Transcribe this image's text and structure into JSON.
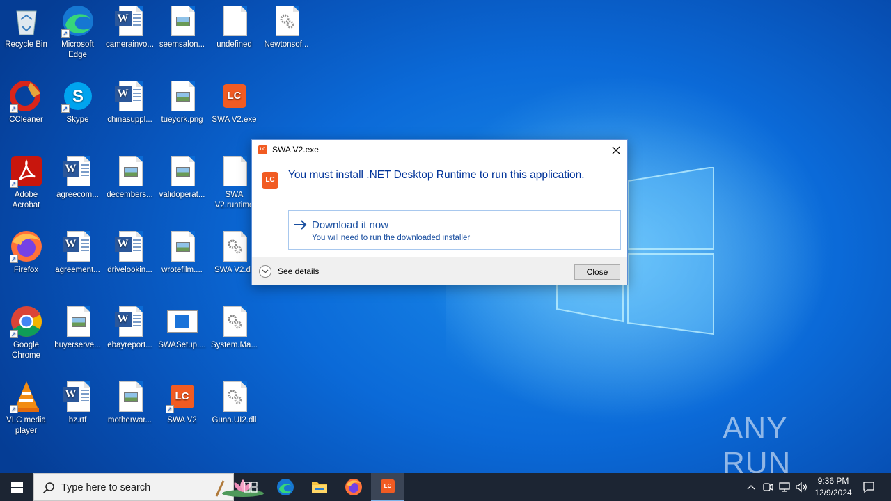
{
  "desktop": {
    "icons": [
      {
        "label": "Recycle Bin",
        "kind": "recycle-bin"
      },
      {
        "label": "Microsoft Edge",
        "kind": "edge"
      },
      {
        "label": "camerainvo...",
        "kind": "word"
      },
      {
        "label": "seemsalon...",
        "kind": "image"
      },
      {
        "label": "undefined",
        "kind": "blank"
      },
      {
        "label": "Newtonsof...",
        "kind": "dll"
      },
      {
        "label": "CCleaner",
        "kind": "ccleaner"
      },
      {
        "label": "Skype",
        "kind": "skype"
      },
      {
        "label": "chinasuppl...",
        "kind": "word"
      },
      {
        "label": "tueyork.png",
        "kind": "image"
      },
      {
        "label": "SWA V2.exe",
        "kind": "lc"
      },
      {
        "label": "Adobe Acrobat",
        "kind": "acrobat"
      },
      {
        "label": "agreecom...",
        "kind": "word"
      },
      {
        "label": "decembers...",
        "kind": "image"
      },
      {
        "label": "validoperat...",
        "kind": "image"
      },
      {
        "label": "SWA V2.runtime",
        "kind": "blank"
      },
      {
        "label": "Firefox",
        "kind": "firefox"
      },
      {
        "label": "agreement...",
        "kind": "word"
      },
      {
        "label": "drivelookin...",
        "kind": "word"
      },
      {
        "label": "wrotefilm....",
        "kind": "image"
      },
      {
        "label": "SWA V2.dll",
        "kind": "dll"
      },
      {
        "label": "Google Chrome",
        "kind": "chrome"
      },
      {
        "label": "buyerserve...",
        "kind": "image"
      },
      {
        "label": "ebayreport...",
        "kind": "word"
      },
      {
        "label": "SWASetup....",
        "kind": "setup"
      },
      {
        "label": "System.Ma...",
        "kind": "dll"
      },
      {
        "label": "VLC media player",
        "kind": "vlc"
      },
      {
        "label": "bz.rtf",
        "kind": "word"
      },
      {
        "label": "motherwar...",
        "kind": "image"
      },
      {
        "label": "SWA V2",
        "kind": "lc"
      },
      {
        "label": "Guna.UI2.dll",
        "kind": "dll"
      }
    ],
    "watermark": "ANY RUN"
  },
  "dialog": {
    "title": "SWA V2.exe",
    "app_icon_text": "LC",
    "heading": "You must install .NET Desktop Runtime to run this application.",
    "command_link": {
      "title": "Download it now",
      "subtitle": "You will need to run the downloaded installer"
    },
    "details_label": "See details",
    "close_label": "Close"
  },
  "taskbar": {
    "search_placeholder": "Type here to search",
    "time": "9:36 PM",
    "date": "12/9/2024",
    "active_app_icon_text": "LC"
  },
  "colors": {
    "accent": "#0a5fc4",
    "lc_orange": "#f15b22",
    "dialog_heading": "#003399",
    "taskbar": "#1c2533"
  }
}
